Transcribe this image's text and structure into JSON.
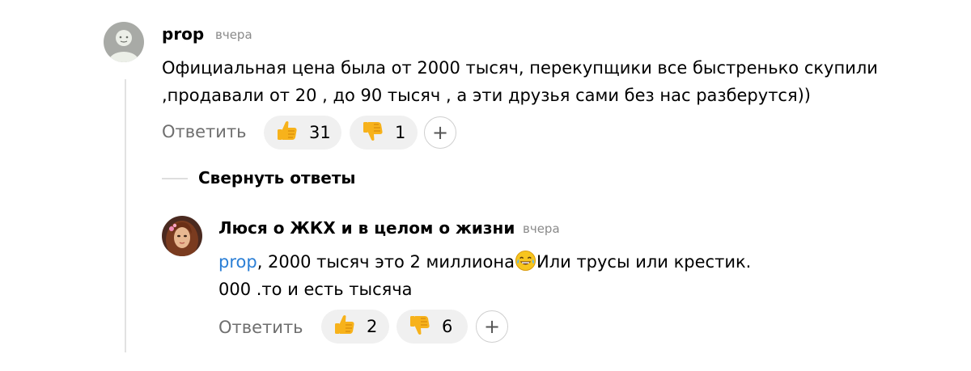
{
  "comment": {
    "author": "prop",
    "time": "вчера",
    "text_line1": "Официальная цена была от 2000 тысяч, перекупщики все быстренько скупили",
    "text_line2": ",продавали от 20 , до 90 тысяч , а эти друзья сами без нас разберутся))",
    "reply_label": "Ответить",
    "likes": "31",
    "dislikes": "1",
    "add_reaction": "+"
  },
  "collapse": {
    "label": "Свернуть ответы"
  },
  "reply": {
    "author": "Люся о ЖКХ и в целом о жизни",
    "time": "вчера",
    "mention": "prop",
    "text_line1_part1": ", 2000 тысяч это 2 миллиона",
    "text_line1_part2": "Или трусы или крестик.",
    "text_line2": "000 .то и есть тысяча",
    "reply_label": "Ответить",
    "likes": "2",
    "dislikes": "6",
    "add_reaction": "+"
  },
  "icons": {
    "like": "thumbs-up-icon",
    "dislike": "thumbs-down-icon",
    "laugh": "tears-of-joy-emoji",
    "plus": "plus-icon"
  },
  "colors": {
    "mention": "#2b7fd6",
    "pill_bg": "#f0f0f0",
    "muted": "#8a8a8a",
    "emoji_yellow": "#f7b21b"
  }
}
